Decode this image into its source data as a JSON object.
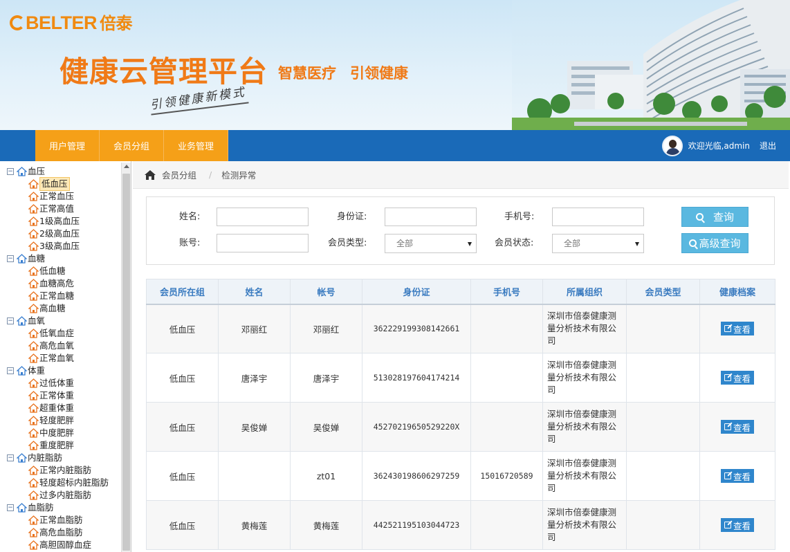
{
  "header": {
    "logo_text": "BELTER",
    "logo_cn": "倍泰",
    "platform_title": "健康云管理平台",
    "slogan_1": "智慧医疗",
    "slogan_2": "引领健康",
    "handwriting": "引领健康新模式"
  },
  "nav": {
    "tabs": [
      {
        "label": "用户管理"
      },
      {
        "label": "会员分组"
      },
      {
        "label": "业务管理"
      }
    ],
    "welcome": "欢迎光临,admin",
    "logout": "退出"
  },
  "sidebar": {
    "groups": [
      {
        "label": "血压",
        "children": [
          "低血压",
          "正常血压",
          "正常高值",
          "1级高血压",
          "2级高血压",
          "3级高血压"
        ]
      },
      {
        "label": "血糖",
        "children": [
          "低血糖",
          "血糖高危",
          "正常血糖",
          "高血糖"
        ]
      },
      {
        "label": "血氧",
        "children": [
          "低氧血症",
          "高危血氧",
          "正常血氧"
        ]
      },
      {
        "label": "体重",
        "children": [
          "过低体重",
          "正常体重",
          "超重体重",
          "轻度肥胖",
          "中度肥胖",
          "重度肥胖"
        ]
      },
      {
        "label": "内脏脂肪",
        "children": [
          "正常内脏脂肪",
          "轻度超标内脏脂肪",
          "过多内脏脂肪"
        ]
      },
      {
        "label": "血脂肪",
        "children": [
          "正常血脂肪",
          "高危血脂肪",
          "高胆固醇血症"
        ]
      }
    ],
    "selected": "低血压"
  },
  "breadcrumb": {
    "items": [
      "会员分组",
      "检测异常"
    ]
  },
  "search": {
    "name_label": "姓名:",
    "id_label": "身份证:",
    "phone_label": "手机号:",
    "account_label": "账号:",
    "member_type_label": "会员类型:",
    "member_status_label": "会员状态:",
    "member_type_value": "全部",
    "member_status_value": "全部",
    "query_button": "查询",
    "advanced_button": "高级查询"
  },
  "table": {
    "headers": [
      "会员所在组",
      "姓名",
      "帐号",
      "身份证",
      "手机号",
      "所属组织",
      "会员类型",
      "健康档案"
    ],
    "view_label": "查看",
    "rows": [
      {
        "group": "低血压",
        "name": "邓丽红",
        "account": "邓丽红",
        "id": "362229199308142661",
        "phone": "",
        "org": "深圳市倍泰健康测量分析技术有限公司",
        "type": ""
      },
      {
        "group": "低血压",
        "name": "唐泽宇",
        "account": "唐泽宇",
        "id": "513028197604174214",
        "phone": "",
        "org": "深圳市倍泰健康测量分析技术有限公司",
        "type": ""
      },
      {
        "group": "低血压",
        "name": "吴俊婵",
        "account": "吴俊婵",
        "id": "45270219650529220X",
        "phone": "",
        "org": "深圳市倍泰健康测量分析技术有限公司",
        "type": ""
      },
      {
        "group": "低血压",
        "name": "",
        "account": "zt01",
        "id": "362430198606297259",
        "phone": "15016720589",
        "org": "深圳市倍泰健康测量分析技术有限公司",
        "type": ""
      },
      {
        "group": "低血压",
        "name": "黄梅莲",
        "account": "黄梅莲",
        "id": "442521195103044723",
        "phone": "",
        "org": "深圳市倍泰健康测量分析技术有限公司",
        "type": ""
      }
    ]
  },
  "colors": {
    "brand_orange": "#f07a17",
    "nav_blue": "#1a6ab8",
    "nav_tab_orange": "#f5a018",
    "button_blue": "#5ab8e0",
    "view_button_blue": "#2f86cc",
    "table_header_text": "#3a7bc0"
  }
}
